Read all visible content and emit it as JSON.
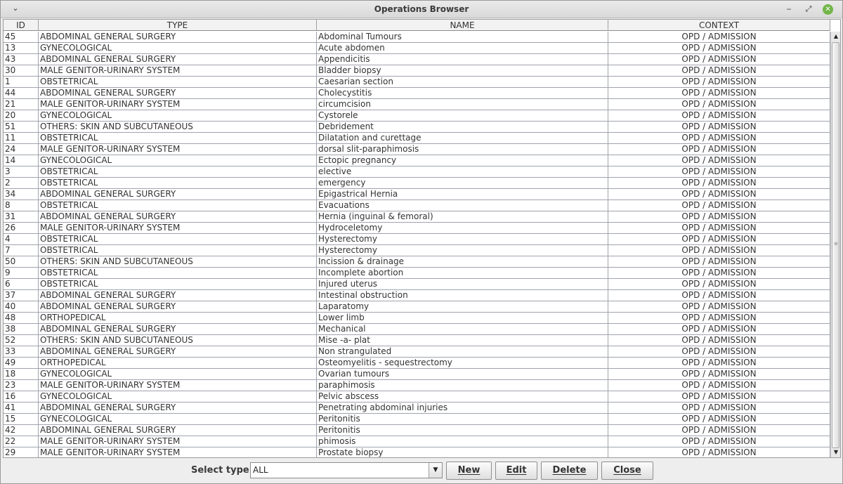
{
  "window": {
    "title": "Operations Browser"
  },
  "columns": [
    "ID",
    "TYPE",
    "NAME",
    "CONTEXT"
  ],
  "rows": [
    [
      "45",
      "ABDOMINAL GENERAL SURGERY",
      "Abdominal Tumours",
      "OPD / ADMISSION"
    ],
    [
      "13",
      "GYNECOLOGICAL",
      "Acute abdomen",
      "OPD / ADMISSION"
    ],
    [
      "43",
      "ABDOMINAL GENERAL SURGERY",
      "Appendicitis",
      "OPD / ADMISSION"
    ],
    [
      "30",
      "MALE GENITOR-URINARY SYSTEM",
      "Bladder biopsy",
      "OPD / ADMISSION"
    ],
    [
      "1",
      "OBSTETRICAL",
      "Caesarian section",
      "OPD / ADMISSION"
    ],
    [
      "44",
      "ABDOMINAL GENERAL SURGERY",
      "Cholecystitis",
      "OPD / ADMISSION"
    ],
    [
      "21",
      "MALE GENITOR-URINARY SYSTEM",
      "circumcision",
      "OPD / ADMISSION"
    ],
    [
      "20",
      "GYNECOLOGICAL",
      "Cystorele",
      "OPD / ADMISSION"
    ],
    [
      "51",
      "OTHERS: SKIN AND SUBCUTANEOUS",
      "Debridement",
      "OPD / ADMISSION"
    ],
    [
      "11",
      "OBSTETRICAL",
      "Dilatation and curettage",
      "OPD / ADMISSION"
    ],
    [
      "24",
      "MALE GENITOR-URINARY SYSTEM",
      "dorsal slit-paraphimosis",
      "OPD / ADMISSION"
    ],
    [
      "14",
      "GYNECOLOGICAL",
      "Ectopic pregnancy",
      "OPD / ADMISSION"
    ],
    [
      "3",
      "OBSTETRICAL",
      "elective",
      "OPD / ADMISSION"
    ],
    [
      "2",
      "OBSTETRICAL",
      "emergency",
      "OPD / ADMISSION"
    ],
    [
      "34",
      "ABDOMINAL GENERAL SURGERY",
      "Epigastrical Hernia",
      "OPD / ADMISSION"
    ],
    [
      "8",
      "OBSTETRICAL",
      "Evacuations",
      "OPD / ADMISSION"
    ],
    [
      "31",
      "ABDOMINAL GENERAL SURGERY",
      "Hernia (inguinal & femoral)",
      "OPD / ADMISSION"
    ],
    [
      "26",
      "MALE GENITOR-URINARY SYSTEM",
      "Hydroceletomy",
      "OPD / ADMISSION"
    ],
    [
      "4",
      "OBSTETRICAL",
      "Hysterectomy",
      "OPD / ADMISSION"
    ],
    [
      "7",
      "OBSTETRICAL",
      "Hysterectomy",
      "OPD / ADMISSION"
    ],
    [
      "50",
      "OTHERS: SKIN AND SUBCUTANEOUS",
      "Incission & drainage",
      "OPD / ADMISSION"
    ],
    [
      "9",
      "OBSTETRICAL",
      "Incomplete abortion",
      "OPD / ADMISSION"
    ],
    [
      "6",
      "OBSTETRICAL",
      "Injured uterus",
      "OPD / ADMISSION"
    ],
    [
      "37",
      "ABDOMINAL GENERAL SURGERY",
      "Intestinal obstruction",
      "OPD / ADMISSION"
    ],
    [
      "40",
      "ABDOMINAL GENERAL SURGERY",
      "Laparatomy",
      "OPD / ADMISSION"
    ],
    [
      "48",
      "ORTHOPEDICAL",
      "Lower limb",
      "OPD / ADMISSION"
    ],
    [
      "38",
      "ABDOMINAL GENERAL SURGERY",
      "Mechanical",
      "OPD / ADMISSION"
    ],
    [
      "52",
      "OTHERS: SKIN AND SUBCUTANEOUS",
      "Mise -a- plat",
      "OPD / ADMISSION"
    ],
    [
      "33",
      "ABDOMINAL GENERAL SURGERY",
      "Non strangulated",
      "OPD / ADMISSION"
    ],
    [
      "49",
      "ORTHOPEDICAL",
      "Osteomyelitis - sequestrectomy",
      "OPD / ADMISSION"
    ],
    [
      "18",
      "GYNECOLOGICAL",
      "Ovarian tumours",
      "OPD / ADMISSION"
    ],
    [
      "23",
      "MALE GENITOR-URINARY SYSTEM",
      "paraphimosis",
      "OPD / ADMISSION"
    ],
    [
      "16",
      "GYNECOLOGICAL",
      "Pelvic abscess",
      "OPD / ADMISSION"
    ],
    [
      "41",
      "ABDOMINAL GENERAL SURGERY",
      "Penetrating abdominal injuries",
      "OPD / ADMISSION"
    ],
    [
      "15",
      "GYNECOLOGICAL",
      "Peritonitis",
      "OPD / ADMISSION"
    ],
    [
      "42",
      "ABDOMINAL GENERAL SURGERY",
      "Peritonitis",
      "OPD / ADMISSION"
    ],
    [
      "22",
      "MALE GENITOR-URINARY SYSTEM",
      "phimosis",
      "OPD / ADMISSION"
    ],
    [
      "29",
      "MALE GENITOR-URINARY SYSTEM",
      "Prostate biopsy",
      "OPD / ADMISSION"
    ]
  ],
  "filter": {
    "label": "Select type",
    "value": "ALL"
  },
  "buttons": {
    "new": "New",
    "edit": "Edit",
    "delete": "Delete",
    "close": "Close"
  },
  "icons": {
    "menu": "chevron-down-icon",
    "minimize": "minimize-icon",
    "maximize": "maximize-icon",
    "close": "close-icon"
  },
  "colors": {
    "close_accent": "#73b54a",
    "grid": "#9fa4ad"
  }
}
